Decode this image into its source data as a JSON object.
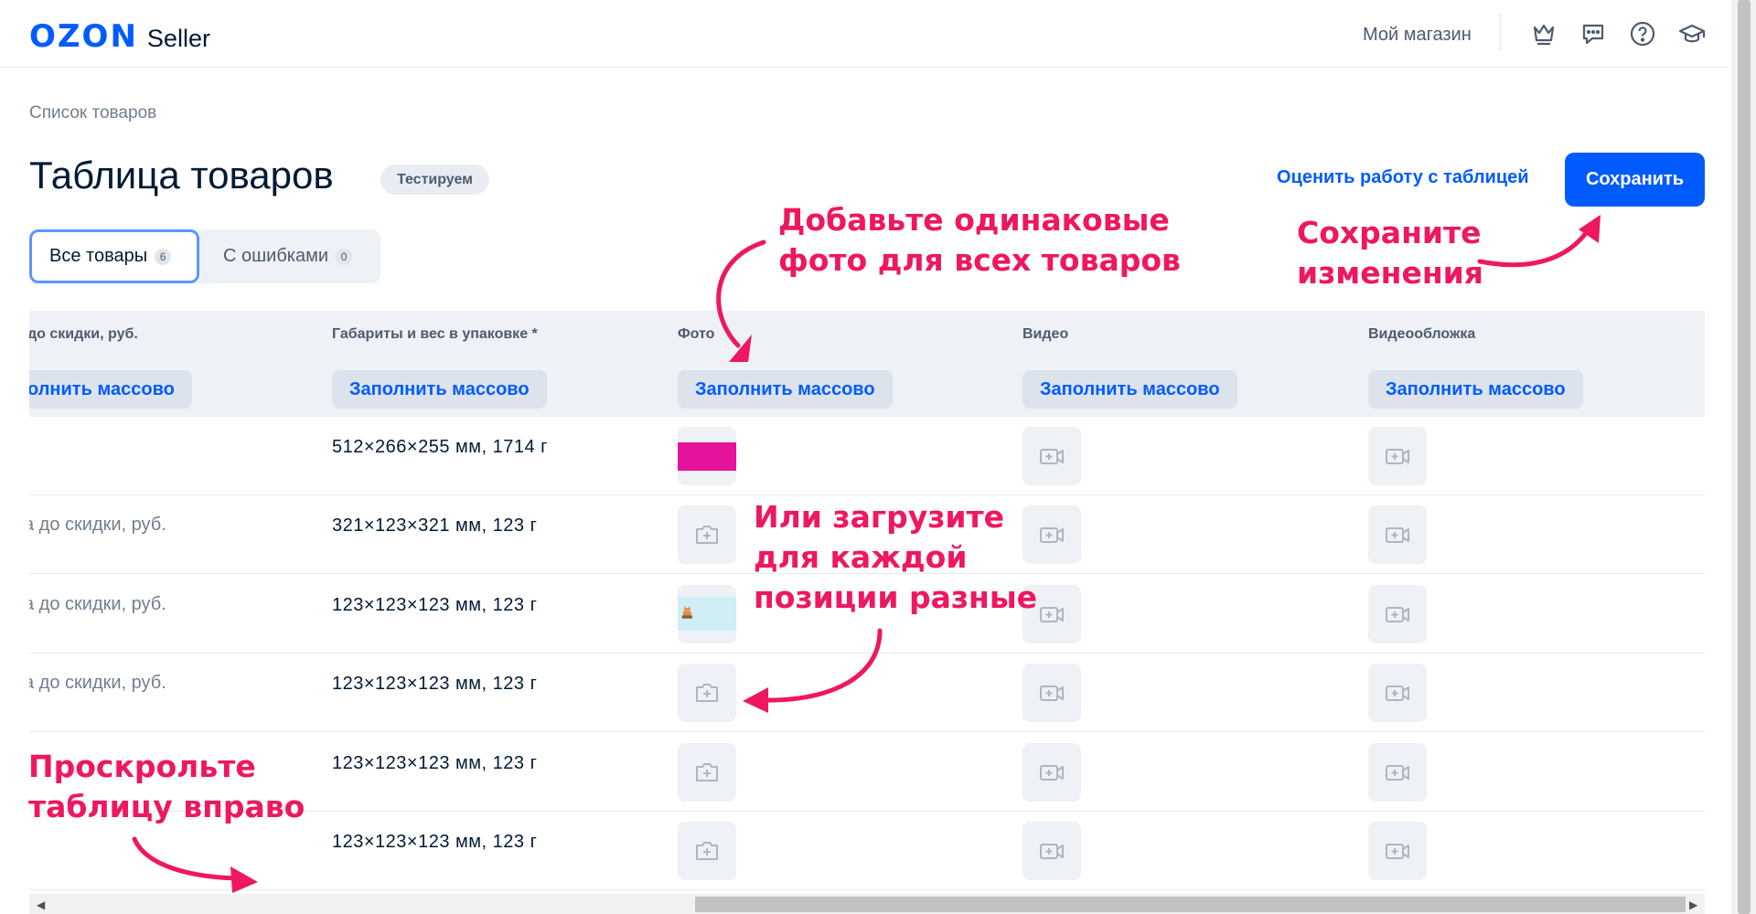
{
  "header": {
    "logo_brand": "OZON",
    "logo_product": "Seller",
    "store_name": "Мой магазин",
    "icons": [
      "crown-icon",
      "chat-icon",
      "help-icon",
      "graduation-cap-icon"
    ]
  },
  "breadcrumb": "Список товаров",
  "page": {
    "title": "Таблица товаров",
    "badge": "Тестируем",
    "rate_link": "Оценить работу с таблицей",
    "save_label": "Сохранить"
  },
  "tabs": [
    {
      "label": "Все товары",
      "count": "6",
      "active": true
    },
    {
      "label": "С ошибками",
      "count": "0",
      "active": false
    }
  ],
  "table": {
    "columns": [
      {
        "label": "до скидки, руб.",
        "fill_label": "олнить массово"
      },
      {
        "label": "Габариты и вес в упаковке *",
        "fill_label": "Заполнить массово"
      },
      {
        "label": "Фото",
        "fill_label": "Заполнить массово"
      },
      {
        "label": "Видео",
        "fill_label": "Заполнить массово"
      },
      {
        "label": "Видеообложка",
        "fill_label": "Заполнить массово"
      }
    ],
    "rows": [
      {
        "price": ")",
        "dims": "512×266×255 мм, 1714 г",
        "photo": "pink"
      },
      {
        "price": "а до скидки, руб.",
        "dims": "321×123×321 мм, 123 г",
        "photo": "empty"
      },
      {
        "price": "а до скидки, руб.",
        "dims": "123×123×123 мм, 123 г",
        "photo": "cat"
      },
      {
        "price": "а до скидки, руб.",
        "dims": "123×123×123 мм, 123 г",
        "photo": "empty"
      },
      {
        "price": "",
        "dims": "123×123×123 мм, 123 г",
        "photo": "empty"
      },
      {
        "price": "",
        "dims": "123×123×123 мм, 123 г",
        "photo": "empty"
      }
    ]
  },
  "annotations": {
    "same_photo": "Добавьте одинаковые\nфото для всех товаров",
    "save_changes": "Сохраните\nизменения",
    "upload_each": "Или загрузите\nдля каждой\nпозиции разные",
    "scroll_right": "Проскрольте\nтаблицу вправо"
  },
  "colors": {
    "accent": "#005bff",
    "annotation": "#ee1760",
    "header_bg": "#eef1f5"
  }
}
